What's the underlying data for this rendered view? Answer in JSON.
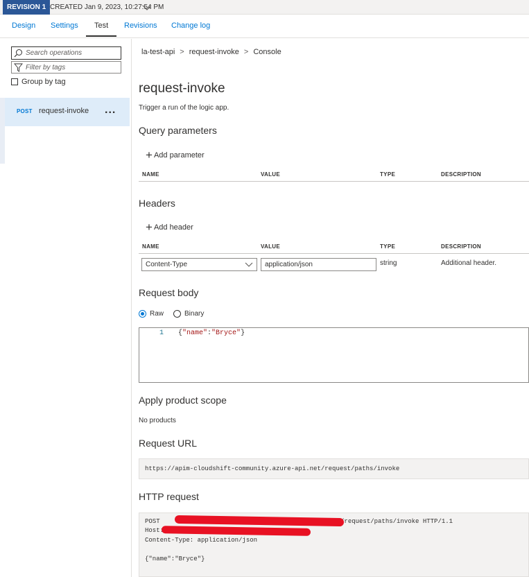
{
  "revision": {
    "badge": "REVISION 1",
    "created": "CREATED Jan 9, 2023, 10:27:54 PM"
  },
  "tabs": [
    {
      "label": "Design"
    },
    {
      "label": "Settings"
    },
    {
      "label": "Test",
      "active": true
    },
    {
      "label": "Revisions"
    },
    {
      "label": "Change log"
    }
  ],
  "sidebar": {
    "search_placeholder": "Search operations",
    "filter_placeholder": "Filter by tags",
    "group_by_tag": "Group by tag",
    "group_by_tag_checked": false,
    "operations": [
      {
        "method": "POST",
        "name": "request-invoke",
        "more": "..."
      }
    ]
  },
  "breadcrumb": [
    "la-test-api",
    ">",
    "request-invoke",
    ">",
    "Console"
  ],
  "operation": {
    "title": "request-invoke",
    "description": "Trigger a run of the logic app."
  },
  "query": {
    "heading": "Query parameters",
    "add_label": "Add parameter",
    "columns": [
      "NAME",
      "VALUE",
      "TYPE",
      "DESCRIPTION"
    ]
  },
  "headers": {
    "heading": "Headers",
    "add_label": "Add header",
    "columns": [
      "NAME",
      "VALUE",
      "TYPE",
      "DESCRIPTION"
    ],
    "rows": [
      {
        "name": "Content-Type",
        "value": "application/json",
        "type": "string",
        "description": "Additional header."
      }
    ]
  },
  "request_body": {
    "heading": "Request body",
    "options": [
      {
        "label": "Raw",
        "selected": true
      },
      {
        "label": "Binary",
        "selected": false
      }
    ],
    "line_number": "1",
    "code_open": "{",
    "code_key": "\"name\"",
    "code_colon": ":",
    "code_value": "\"Bryce\"",
    "code_close": "}"
  },
  "product_scope": {
    "heading": "Apply product scope",
    "value": "No products"
  },
  "request_url": {
    "heading": "Request URL",
    "value": "https://apim-cloudshift-community.azure-api.net/request/paths/invoke"
  },
  "http_request": {
    "heading": "HTTP request",
    "line1_prefix": "POST ",
    "line1_suffix": "/request/paths/invoke HTTP/1.1",
    "line2": "Host:",
    "line3": "Content-Type: application/json",
    "line5": "{\"name\":\"Bryce\"}"
  },
  "colors": {
    "accent": "#0078d4",
    "revision_badge": "#2b5797",
    "redaction": "#e81123"
  }
}
